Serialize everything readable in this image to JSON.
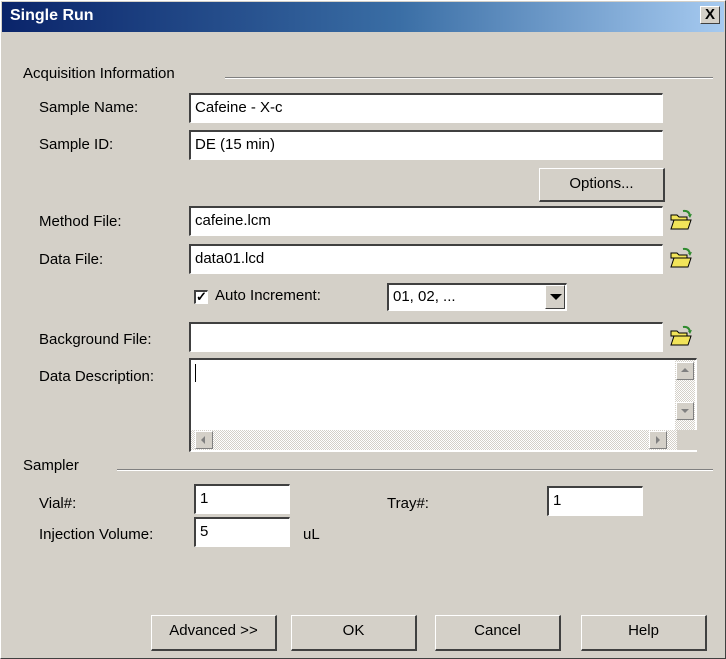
{
  "window": {
    "title": "Single Run",
    "close_glyph": "X"
  },
  "acquisition": {
    "group_label": "Acquisition Information",
    "sample_name_label": "Sample Name:",
    "sample_name_value": "Cafeine - X-c",
    "sample_id_label": "Sample ID:",
    "sample_id_value": "DE (15 min)",
    "options_button": "Options...",
    "method_file_label": "Method File:",
    "method_file_value": "cafeine.lcm",
    "data_file_label": "Data File:",
    "data_file_value": "data01.lcd",
    "auto_increment_checked": true,
    "auto_increment_label": "Auto Increment:",
    "auto_increment_value": "01, 02, ...",
    "background_file_label": "Background File:",
    "background_file_value": "",
    "data_description_label": "Data Description:",
    "data_description_value": ""
  },
  "sampler": {
    "group_label": "Sampler",
    "vial_label": "Vial#:",
    "vial_value": "1",
    "tray_label": "Tray#:",
    "tray_value": "1",
    "injection_volume_label": "Injection Volume:",
    "injection_volume_value": "5",
    "injection_volume_unit": "uL"
  },
  "buttons": {
    "advanced": "Advanced >>",
    "ok": "OK",
    "cancel": "Cancel",
    "help": "Help"
  },
  "icons": {
    "folder_open": "folder-open-icon",
    "close": "close-icon",
    "check": "check-icon",
    "dropdown": "chevron-down-icon"
  },
  "colors": {
    "titlebar_start": "#0a246a",
    "titlebar_end": "#a6caf0",
    "dialog_face": "#d4d0c8",
    "folder_yellow": "#f2e45a",
    "folder_arrow": "#2e8b2e"
  }
}
